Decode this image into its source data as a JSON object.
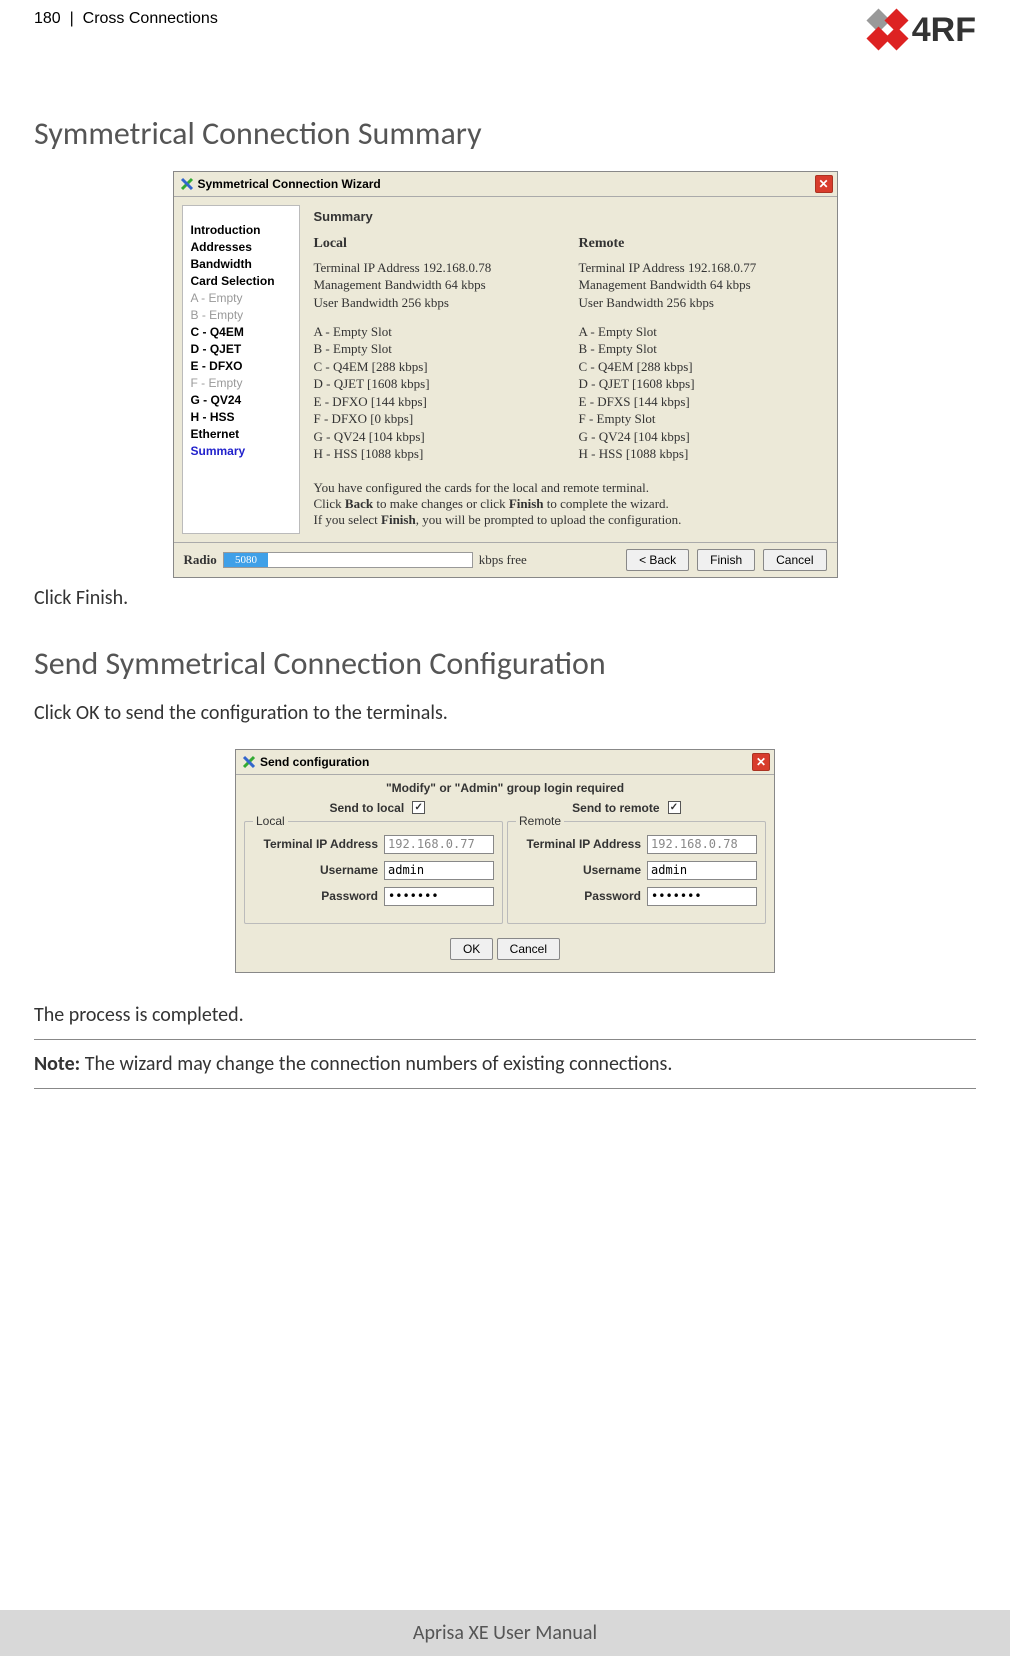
{
  "header": {
    "page_num": "180",
    "sep": "|",
    "chapter": "Cross Connections",
    "logo_text": "4RF"
  },
  "section1": {
    "title": "Symmetrical Connection Summary",
    "after_text": "Click Finish."
  },
  "wizard": {
    "title": "Symmetrical Connection Wizard",
    "summary_label": "Summary",
    "sidebar": [
      {
        "text": "Introduction",
        "cls": "sde-bold"
      },
      {
        "text": "Addresses",
        "cls": "sde-bold"
      },
      {
        "text": "Bandwidth",
        "cls": "sde-bold"
      },
      {
        "text": "Card Selection",
        "cls": "sde-bold"
      },
      {
        "text": "A - Empty",
        "cls": "sde-grey"
      },
      {
        "text": "B - Empty",
        "cls": "sde-grey"
      },
      {
        "text": "C - Q4EM",
        "cls": "sde-bold"
      },
      {
        "text": "D - QJET",
        "cls": "sde-bold"
      },
      {
        "text": "E - DFXO",
        "cls": "sde-bold"
      },
      {
        "text": "F - Empty",
        "cls": "sde-grey"
      },
      {
        "text": "G - QV24",
        "cls": "sde-bold"
      },
      {
        "text": "H - HSS",
        "cls": "sde-bold"
      },
      {
        "text": "Ethernet",
        "cls": "sde-bold"
      },
      {
        "text": "Summary",
        "cls": "sde-blue"
      }
    ],
    "local": {
      "head": "Local",
      "ip": "Terminal IP Address 192.168.0.78",
      "mgmt": "Management Bandwidth 64 kbps",
      "user": "User Bandwidth 256 kbps",
      "slots": [
        "A - Empty Slot",
        "B - Empty Slot",
        "C - Q4EM [288 kbps]",
        "D - QJET [1608 kbps]",
        "E - DFXO [144 kbps]",
        "F - DFXO [0 kbps]",
        "G - QV24 [104 kbps]",
        "H - HSS [1088 kbps]"
      ]
    },
    "remote": {
      "head": "Remote",
      "ip": "Terminal IP Address 192.168.0.77",
      "mgmt": "Management Bandwidth 64 kbps",
      "user": "User Bandwidth 256 kbps",
      "slots": [
        "A - Empty Slot",
        "B - Empty Slot",
        "C - Q4EM [288 kbps]",
        "D - QJET [1608 kbps]",
        "E - DFXS [144 kbps]",
        "F - Empty Slot",
        "G - QV24 [104 kbps]",
        "H - HSS [1088 kbps]"
      ]
    },
    "foot1": "You have configured the cards for the local and remote terminal.",
    "foot2a": "Click ",
    "foot2b": "Back",
    "foot2c": " to make changes or click ",
    "foot2d": "Finish",
    "foot2e": " to complete the wizard.",
    "foot3a": "If you select ",
    "foot3b": "Finish",
    "foot3c": ", you will be prompted to upload the configuration.",
    "radio_label": "Radio",
    "prog_value": "5080",
    "prog_suffix": "kbps free",
    "btn_back": "< Back",
    "btn_finish": "Finish",
    "btn_cancel": "Cancel"
  },
  "section2": {
    "title": "Send Symmetrical Connection Configuration",
    "pre_text": "Click OK to send the configuration to the terminals."
  },
  "send": {
    "title": "Send configuration",
    "header": "\"Modify\" or \"Admin\" group login required",
    "send_local": "Send to local",
    "send_remote": "Send to remote",
    "local_label": "Local",
    "remote_label": "Remote",
    "ip_label": "Terminal IP Address",
    "user_label": "Username",
    "pass_label": "Password",
    "local_ip": "192.168.0.77",
    "remote_ip": "192.168.0.78",
    "local_user": "admin",
    "remote_user": "admin",
    "pass_mask": "*******",
    "btn_ok": "OK",
    "btn_cancel": "Cancel"
  },
  "after": {
    "completed": "The process is completed.",
    "note_label": "Note:",
    "note_text": " The wizard may change the connection numbers of existing connections."
  },
  "footer": "Aprisa XE User Manual"
}
